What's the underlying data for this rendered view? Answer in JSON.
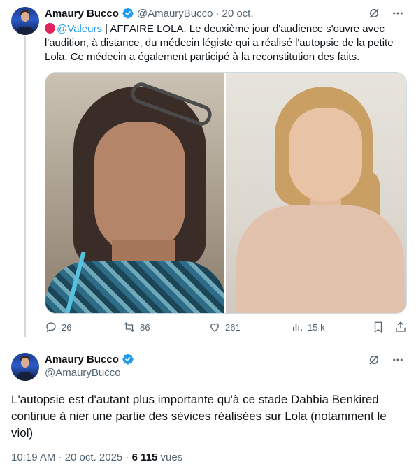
{
  "tweet1": {
    "author_name": "Amaury Bucco",
    "author_handle": "@AmauryBucco",
    "separator": "·",
    "date": "20 oct.",
    "mention": "@Valeurs",
    "text": " | AFFAIRE LOLA. Le deuxième jour d'audience s'ouvre avec l'audition, à distance, du médecin légiste qui a réalisé l'autopsie de la petite Lola. Ce médecin a également participé à la reconstitution des faits.",
    "stats": {
      "replies": "26",
      "reposts": "86",
      "likes": "261",
      "views": "15 k"
    }
  },
  "tweet2": {
    "author_name": "Amaury Bucco",
    "author_handle": "@AmauryBucco",
    "text": "L'autopsie est d'autant plus importante qu'à ce stade Dahbia Benkired continue à nier une partie des sévices réalisées sur Lola (notamment le viol)",
    "time": "10:19 AM · 20 oct. 2025 · ",
    "views_count": "6 115",
    "views_label": " vues"
  },
  "icons": [
    "verified-badge-icon",
    "grok-icon",
    "more-icon",
    "reply-icon",
    "repost-icon",
    "like-icon",
    "views-icon",
    "bookmark-icon",
    "share-icon"
  ],
  "colors": {
    "accent": "#1d9bf0",
    "secondary_text": "#536471",
    "primary_text": "#0f1419",
    "red_circle": "#e0245e"
  }
}
